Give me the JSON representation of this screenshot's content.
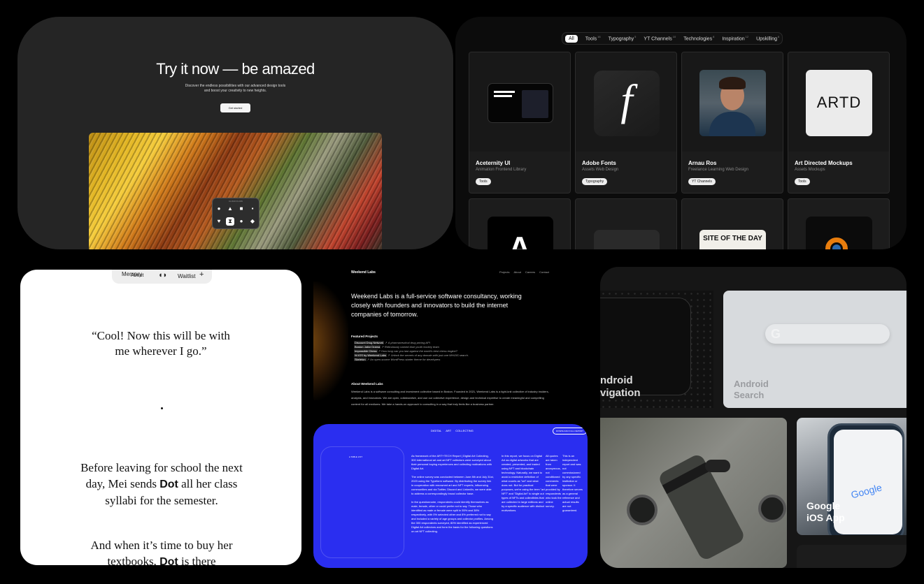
{
  "card1": {
    "title": "Try it now — be amazed",
    "subtitle_line1": "Discover the endless possibilities with our advanced design tools",
    "subtitle_line2": "and boost your creativity to new heights.",
    "cta": "Get started",
    "palette_label": "CLOUD FLOW"
  },
  "card2": {
    "filters": [
      {
        "label": "All",
        "count": ""
      },
      {
        "label": "Tools",
        "count": "16"
      },
      {
        "label": "Typography",
        "count": "5"
      },
      {
        "label": "YT Channels",
        "count": "10"
      },
      {
        "label": "Technologies",
        "count": "8"
      },
      {
        "label": "Inspiration",
        "count": "12"
      },
      {
        "label": "Upskilling",
        "count": "6"
      }
    ],
    "tiles": [
      {
        "name": "Aceternity UI",
        "tags": "Animation   Frontend   Library",
        "pill": "Tools"
      },
      {
        "name": "Adobe Fonts",
        "tags": "Assets   Web Design",
        "pill": "Typography"
      },
      {
        "name": "Arnau Ros",
        "tags": "Freelance   Learning   Web Design",
        "pill": "YT Channels"
      },
      {
        "name": "Art Directed Mockups",
        "tags": "Assets   Mockups",
        "pill": "Tools"
      }
    ],
    "adobe_glyph": "f",
    "artd_logo": "ARTD",
    "site_of_day": "SITE OF THE DAY"
  },
  "card3": {
    "nav_memory": "Memory",
    "nav_about": "About",
    "nav_waitlist": "Waitlist",
    "nav_plus": "+",
    "quote": "“Cool! Now this will be with me wherever I go.”",
    "p1_before": "Before leaving for school the next day, Mei sends ",
    "p1_bold": "Dot",
    "p1_after": " all her class syllabi for the semester.",
    "p2_before": "And when it’s time to buy her textbooks, ",
    "p2_bold": "Dot",
    "p2_after": " is there"
  },
  "card4": {
    "brand": "Weekend Labs",
    "menu": [
      "Projects",
      "About",
      "Careers",
      "Contact"
    ],
    "lead": "Weekend Labs is a full-service software consultancy, working closely with founders and innovators to build the internet companies of tomorrow.",
    "featured_heading": "Featured Projects",
    "projects": [
      {
        "name": "Discount Drug Network",
        "desc": "A pharmaceutical drug pricing API"
      },
      {
        "name": "Boston Jailor Drama",
        "desc": "Ridiculously named blue youth hockey team"
      },
      {
        "name": "Impossible Chess",
        "desc": "How long can you last against the world's best chess engine?"
      },
      {
        "name": "W-IOS by Weekend Labs",
        "desc": "Unlock the secrets of any domain with just one WHOIS search."
      },
      {
        "name": "Skeleton",
        "desc": "An open-source WordPress starter theme for developers"
      }
    ],
    "about_heading": "About Weekend Labs",
    "about_body": "Weekend Labs is a software consulting and investment collective based in Boston. Founded in 2021, Weekend Labs is a tight-knit collective of industry insiders, analysts, and innovators. We are open, collaborative, and use our collective experience, design and technical expertise to create meaningful and compelling content for all mediums. We take a hands-on approach to consulting in a way that truly feels like a business partner."
  },
  "card5": {
    "tabs": [
      "DIGITAL",
      "ART",
      "COLLECTING"
    ],
    "download": "DOWNLOAD FULL REPORT",
    "panel_label": "● TABLE LIST",
    "col1": "As framework of the ART+TECH Report | Digital Art Collecting, 300 international art and art NFT collectors were surveyed about their personal buying experiences and collecting motivations with Digital Art.\n\nThe online survey was conducted between June 8th and July 31st, 2023 using the Typeform software. By distributing the survey link in cooperation with renowned art and NFT experts, influencing communities and via Twitter, Discord and LinkedIn, we were able to address a correspondingly broad collector base.\n\nIn the questionnaire, respondents could identify themselves as male, female, other or could prefer not to say. Those who identified as male or female were split in 55% and 38% respectively, with 0% selected other and 8% preferred not to say and included a variety of age groups and collector profiles. Among the 300 respondents surveyed, 80% identified as experienced Digital Art collectors and form the basis for the following questions on art NFT collecting.",
    "col2": "In this report, we focus on Digital Art as digital artworks that are created, presented, and traded using NFT and blockchain technology. Naturally, we want to avoid a restrictive definition of what counts as \"art\" and what does not. But for practical purposes, we're using the term \"art NFT\" and \"Digital Art\" to single out types of NFTs and collectibles that are collected in large editions and by a specific audience with distinct motivations.",
    "col3": "All quotes are taken from anonymous, not conditioned comments that were provided by respondents who took the online survey.",
    "col4": "This is an independent report and was not commissioned by any specific institution or sponsor. It therefore serves as a general reference and actual results are not guaranteed."
  },
  "card6": {
    "tile1_line1": "ndroid",
    "tile1_line2": "vigation",
    "tile2_line1": "Android",
    "tile2_line2": "Search",
    "tile2_logo": "G",
    "tile4_line1": "Google",
    "tile4_line2": "iOS App",
    "tile4_logo": "Google"
  }
}
